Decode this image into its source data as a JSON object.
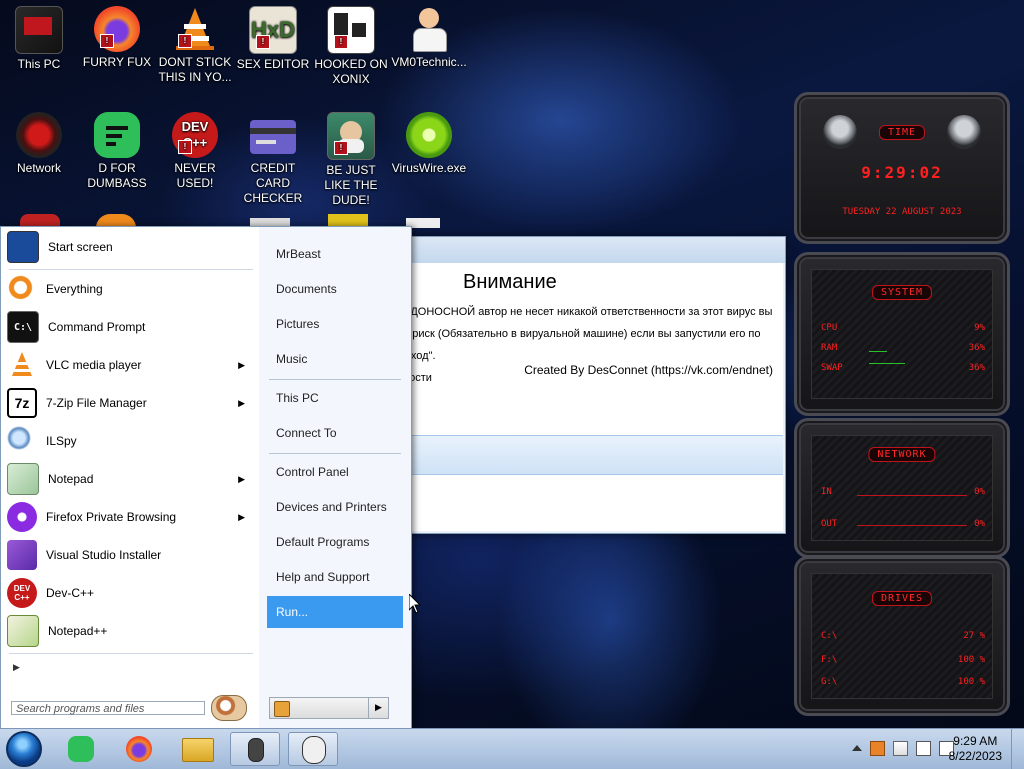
{
  "desktop": {
    "icons": [
      {
        "label": "This PC"
      },
      {
        "label": "FURRY FUX"
      },
      {
        "label": "DONT STICK THIS IN YO..."
      },
      {
        "label": "SEX EDITOR"
      },
      {
        "label": "HOOKED ON XONIX"
      },
      {
        "label": "VM0Technic..."
      },
      {
        "label": "Network"
      },
      {
        "label": "D FOR DUMBASS"
      },
      {
        "label": "NEVER USED!"
      },
      {
        "label": "CREDIT CARD CHECKER"
      },
      {
        "label": "BE JUST LIKE THE DUDE!"
      },
      {
        "label": "VirusWire.exe"
      }
    ]
  },
  "dialog": {
    "heading": "Внимание",
    "line1": "ЕДОНОСНОЙ автор не несет никакой ответственности за этот вирус вы",
    "line2": "й риск (Обязательно в вируальной машине) если вы запустили его по",
    "line3": "ыход\".",
    "line4": "ности",
    "credit": "Created By DesConnet (https://vk.com/endnet)"
  },
  "start_menu": {
    "programs": [
      {
        "label": "Start screen",
        "has_arrow": false
      },
      {
        "label": "Everything",
        "has_arrow": false
      },
      {
        "label": "Command Prompt",
        "has_arrow": false
      },
      {
        "label": "VLC media player",
        "has_arrow": true
      },
      {
        "label": "7-Zip File Manager",
        "has_arrow": true
      },
      {
        "label": "ILSpy",
        "has_arrow": false
      },
      {
        "label": "Notepad",
        "has_arrow": true
      },
      {
        "label": "Firefox Private Browsing",
        "has_arrow": true
      },
      {
        "label": "Visual Studio Installer",
        "has_arrow": false
      },
      {
        "label": "Dev-C++",
        "has_arrow": false
      },
      {
        "label": "Notepad++",
        "has_arrow": false
      }
    ],
    "arrow_glyph": "▶",
    "all_programs_glyph": "▶",
    "search_placeholder": "Search programs and files",
    "right_links": [
      {
        "label": "MrBeast"
      },
      {
        "label": "Documents"
      },
      {
        "label": "Pictures"
      },
      {
        "label": "Music"
      },
      {
        "label": "This PC"
      },
      {
        "label": "Connect To"
      },
      {
        "label": "Control Panel"
      },
      {
        "label": "Devices and Printers"
      },
      {
        "label": "Default Programs"
      },
      {
        "label": "Help and Support"
      },
      {
        "label": "Run..."
      }
    ],
    "highlighted": "Run...",
    "shutdown_arrow": "▶"
  },
  "taskbar": {
    "time": "9:29 AM",
    "date": "8/22/2023",
    "pinned": [
      "notes-app",
      "firefox",
      "file-explorer",
      "mouse-app",
      "jigsaw-app"
    ]
  },
  "gadgets": {
    "time": {
      "title": "TIME",
      "clock": "9:29:02",
      "date": "TUESDAY 22 AUGUST 2023"
    },
    "system": {
      "title": "SYSTEM",
      "rows": [
        {
          "label": "CPU",
          "value": "9%"
        },
        {
          "label": "RAM",
          "value": "36%"
        },
        {
          "label": "SWAP",
          "value": "36%"
        }
      ]
    },
    "network": {
      "title": "NETWORK",
      "rows": [
        {
          "label": "IN",
          "value": "0%"
        },
        {
          "label": "OUT",
          "value": "0%"
        }
      ]
    },
    "drives": {
      "title": "DRIVES",
      "rows": [
        {
          "label": "C:\\",
          "value": "27 %"
        },
        {
          "label": "F:\\",
          "value": "100 %"
        },
        {
          "label": "G:\\",
          "value": "100 %"
        }
      ]
    }
  },
  "colors": {
    "accent_red": "#ff2020",
    "highlight_blue": "#3a9af0"
  }
}
